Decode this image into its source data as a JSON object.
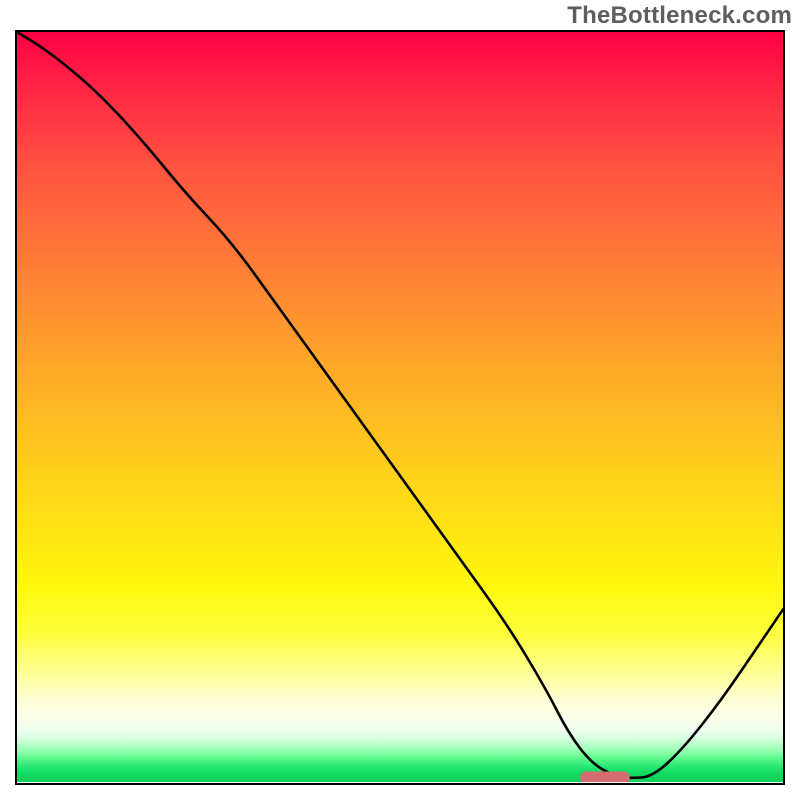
{
  "watermark": "TheBottleneck.com",
  "chart_data": {
    "type": "line",
    "title": "",
    "xlabel": "",
    "ylabel": "",
    "xlim": [
      0,
      100
    ],
    "ylim": [
      0,
      100
    ],
    "grid": false,
    "legend": false,
    "x": [
      0,
      4,
      10,
      16,
      22,
      28,
      34,
      40,
      46,
      52,
      58,
      64,
      69,
      72,
      75,
      78,
      80,
      83,
      87,
      92,
      97,
      100
    ],
    "values": [
      100,
      97.5,
      92.5,
      86,
      78.5,
      72,
      63.5,
      55,
      46.5,
      38,
      29.5,
      21,
      12.5,
      6.5,
      2.5,
      0.8,
      0.5,
      0.7,
      4.5,
      11,
      18.5,
      23
    ],
    "optimal_marker": {
      "x_start": 73.5,
      "x_end": 80,
      "y": 0.6
    },
    "background_gradient_stops": [
      {
        "pos": 0,
        "color": "#ff0042"
      },
      {
        "pos": 25,
        "color": "#ff6a3c"
      },
      {
        "pos": 50,
        "color": "#ffb824"
      },
      {
        "pos": 74,
        "color": "#fff80d"
      },
      {
        "pos": 90,
        "color": "#fbffe8"
      },
      {
        "pos": 97,
        "color": "#49f483"
      },
      {
        "pos": 100,
        "color": "#0fd25b"
      }
    ]
  }
}
